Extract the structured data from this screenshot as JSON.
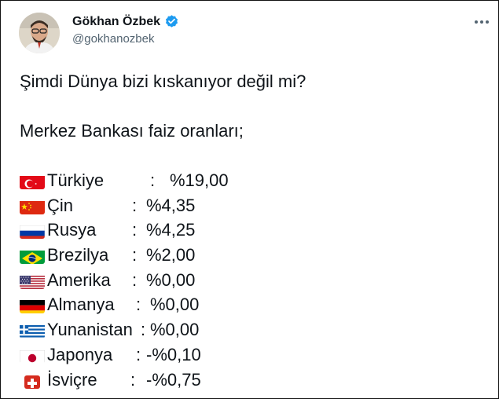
{
  "author": {
    "name": "Gökhan Özbek",
    "handle": "@gokhanozbek"
  },
  "icons": {
    "verified": "verified-badge-icon",
    "more": "more-horizontal-icon"
  },
  "tweet": {
    "line1": "Şimdi Dünya bizi kıskanıyor değil mi?",
    "line2": "Merkez Bankası faiz oranları;",
    "rates": [
      {
        "country": "Türkiye",
        "colon": ":",
        "value": "%19,00",
        "flag": "flag-turkey-icon"
      },
      {
        "country": "Çin",
        "colon": ":",
        "value": "%4,35",
        "flag": "flag-china-icon"
      },
      {
        "country": "Rusya",
        "colon": ":",
        "value": "%4,25",
        "flag": "flag-russia-icon"
      },
      {
        "country": "Brezilya",
        "colon": ":",
        "value": "%2,00",
        "flag": "flag-brazil-icon"
      },
      {
        "country": "Amerika",
        "colon": ":",
        "value": "%0,00",
        "flag": "flag-usa-icon"
      },
      {
        "country": "Almanya",
        "colon": ":",
        "value": "%0,00",
        "flag": "flag-germany-icon"
      },
      {
        "country": "Yunanistan",
        "colon": ":",
        "value": "%0,00",
        "flag": "flag-greece-icon"
      },
      {
        "country": "Japonya",
        "colon": ":",
        "value": "-%0,10",
        "flag": "flag-japan-icon"
      },
      {
        "country": "İsviçre",
        "colon": ":",
        "value": "-%0,75",
        "flag": "flag-switzerland-icon"
      }
    ]
  },
  "colors": {
    "verified": "#1d9bf0",
    "text": "#0f1419",
    "secondary": "#536471"
  }
}
